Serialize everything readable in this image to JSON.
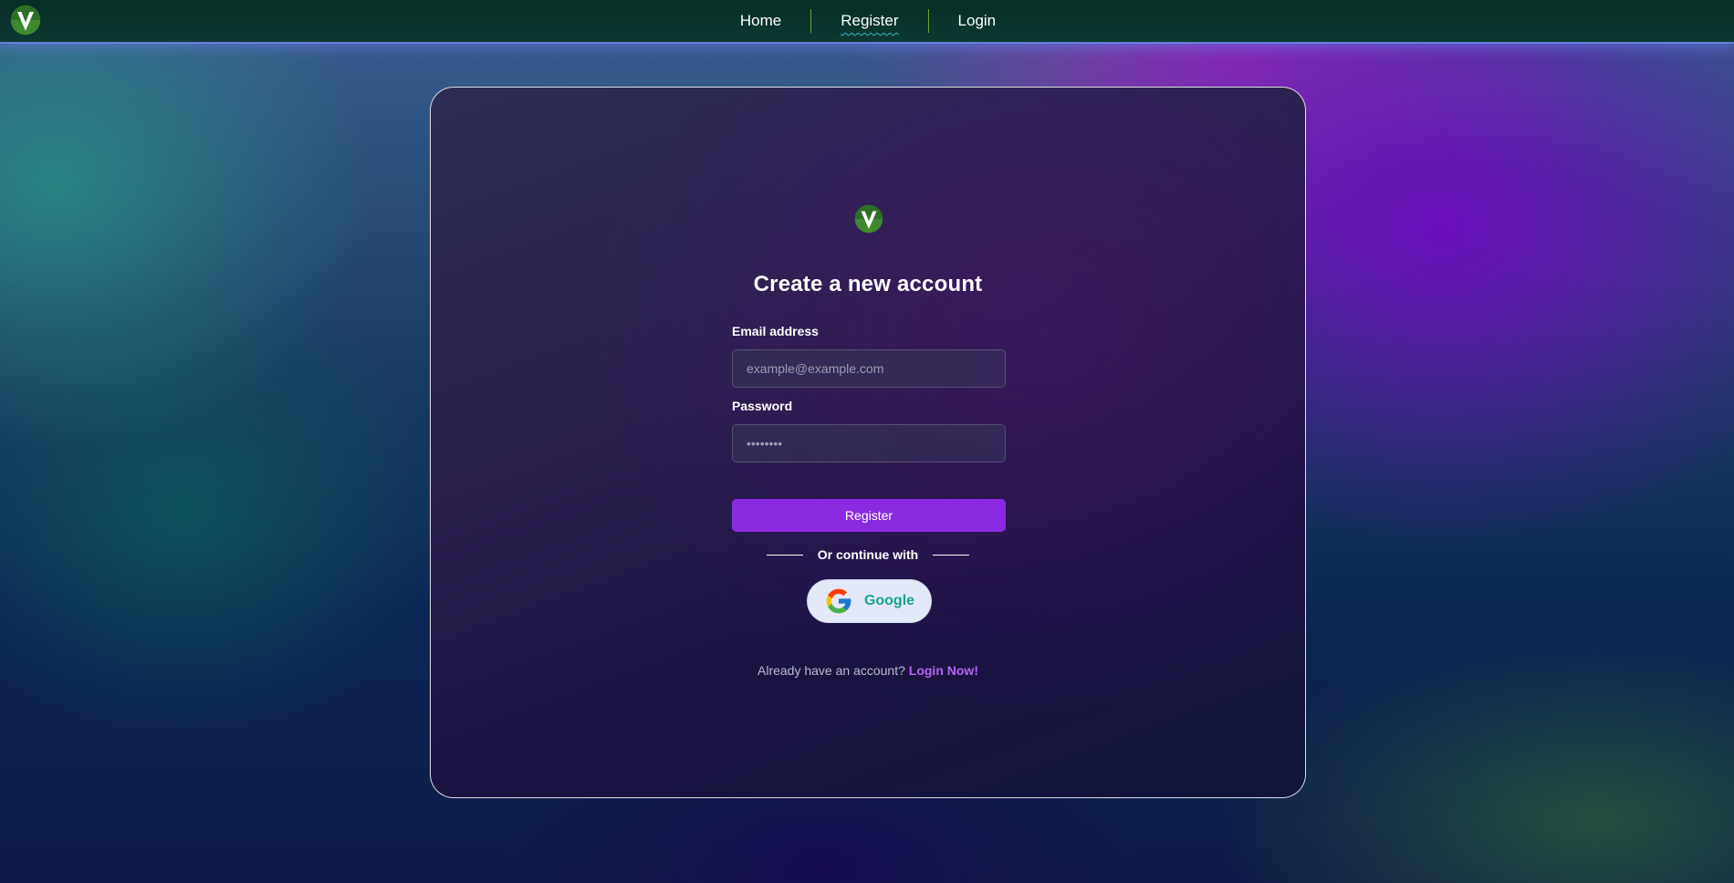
{
  "nav": {
    "items": [
      {
        "label": "Home"
      },
      {
        "label": "Register"
      },
      {
        "label": "Login"
      }
    ],
    "active_index": 1
  },
  "form": {
    "title": "Create a new account",
    "email": {
      "label": "Email address",
      "placeholder": "example@example.com",
      "value": ""
    },
    "password": {
      "label": "Password",
      "placeholder": "••••••••",
      "value": ""
    },
    "submit_label": "Register",
    "divider_text": "Or continue with",
    "google_label": "Google"
  },
  "footer": {
    "prompt": "Already have an account?",
    "link_label": "Login Now!"
  },
  "colors": {
    "accent": "#8a2be2",
    "link": "#b565f2",
    "google_text": "#17a589",
    "logo_green": "#2f7d2a"
  },
  "icons": {
    "brand": "v-logo-icon",
    "google": "google-g-icon"
  }
}
